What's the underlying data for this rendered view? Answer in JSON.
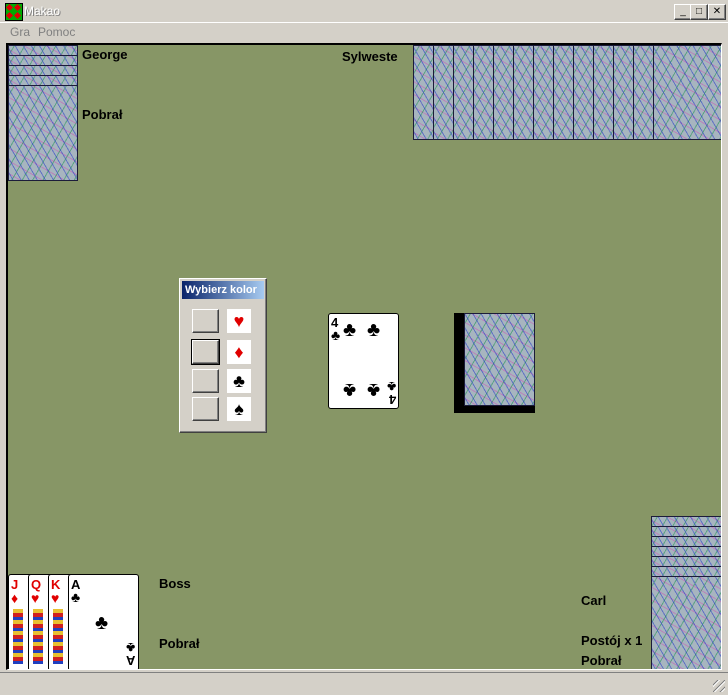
{
  "window": {
    "title": "Makao",
    "minimize": "_",
    "maximize": "□",
    "close": "✕"
  },
  "menu": [
    "Gra",
    "Pomoc"
  ],
  "players": {
    "george": {
      "name": "George",
      "status": "Pobrał"
    },
    "sylweste": {
      "name": "Sylweste"
    },
    "boss": {
      "name": "Boss",
      "status": "Pobrał"
    },
    "carl": {
      "name": "Carl",
      "status_stop": "Postój x 1",
      "status": "Pobrał"
    }
  },
  "table_center": {
    "discard_card": {
      "rank": "4",
      "suit": "♣",
      "color": "black"
    },
    "draw_pile": "card-back"
  },
  "suit_dialog": {
    "title": "Wybierz kolor",
    "options": [
      {
        "suit": "heart",
        "glyph": "♥",
        "color": "#e00000"
      },
      {
        "suit": "diamond",
        "glyph": "♦",
        "color": "#e00000"
      },
      {
        "suit": "club",
        "glyph": "♣",
        "color": "#000000"
      },
      {
        "suit": "spade",
        "glyph": "♠",
        "color": "#000000"
      }
    ]
  },
  "boss_hand": [
    {
      "rank": "J",
      "suit": "♦",
      "color": "red"
    },
    {
      "rank": "Q",
      "suit": "♥",
      "color": "red"
    },
    {
      "rank": "K",
      "suit": "♥",
      "color": "red"
    },
    {
      "rank": "A",
      "suit": "♣",
      "color": "black"
    }
  ],
  "colors": {
    "table": "#879666",
    "card_back": "#a7b5bf"
  }
}
